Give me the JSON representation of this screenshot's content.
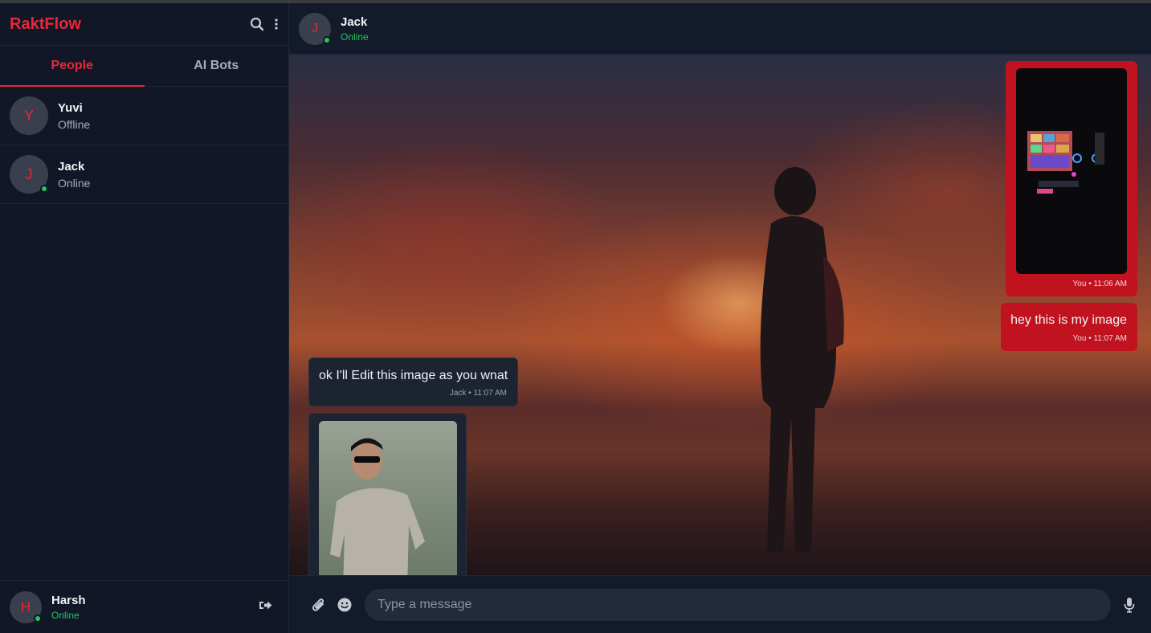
{
  "app": {
    "brand": "RaktFlow"
  },
  "sidebar": {
    "tabs": [
      {
        "label": "People",
        "active": true
      },
      {
        "label": "AI Bots",
        "active": false
      }
    ],
    "contacts": [
      {
        "initial": "Y",
        "name": "Yuvi",
        "status": "Offline",
        "online": false
      },
      {
        "initial": "J",
        "name": "Jack",
        "status": "Online",
        "online": true
      }
    ],
    "me": {
      "initial": "H",
      "name": "Harsh",
      "status": "Online"
    }
  },
  "chat": {
    "header": {
      "initial": "J",
      "name": "Jack",
      "status": "Online"
    },
    "messages": [
      {
        "direction": "out",
        "type": "image",
        "image": "gaming-setup-photo",
        "meta": "You • 11:06 AM"
      },
      {
        "direction": "out",
        "type": "text",
        "text": "hey this is my image",
        "meta": "You • 11:07 AM"
      },
      {
        "direction": "in",
        "type": "text",
        "text": "ok I'll Edit this image as you wnat",
        "meta": "Jack • 11:07 AM"
      },
      {
        "direction": "in",
        "type": "image",
        "image": "portrait-photo"
      }
    ],
    "composer": {
      "placeholder": "Type a message"
    }
  },
  "colors": {
    "accent": "#e5283a",
    "online": "#22c55e",
    "outgoing_bubble": "#c1121f"
  }
}
